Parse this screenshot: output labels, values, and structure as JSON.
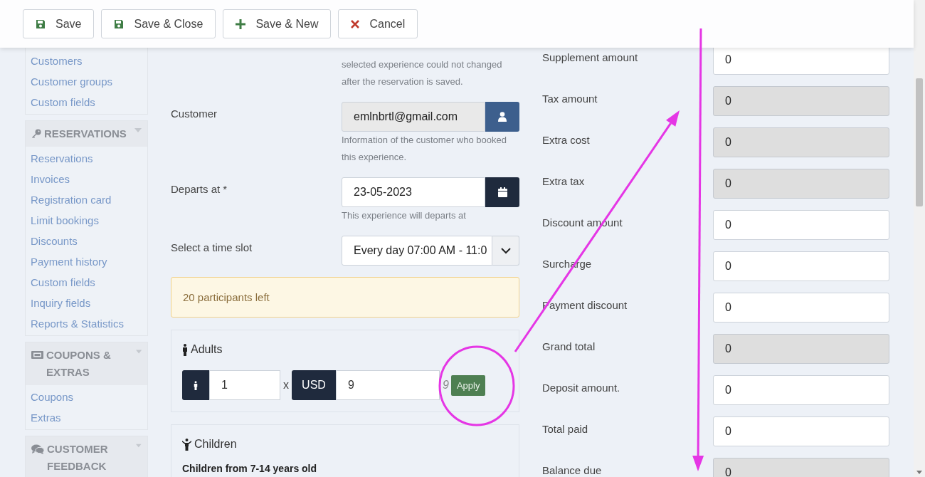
{
  "toolbar": {
    "buttons": [
      {
        "label": "Save",
        "kind": "save"
      },
      {
        "label": "Save & Close",
        "kind": "save"
      },
      {
        "label": "Save & New",
        "kind": "plus"
      },
      {
        "label": "Cancel",
        "kind": "cancel"
      }
    ]
  },
  "sidebar": {
    "groups": [
      {
        "items": [
          "Customers",
          "Customer groups",
          "Custom fields"
        ]
      },
      {
        "title": "RESERVATIONS",
        "kind": "key",
        "items": [
          "Reservations",
          "Invoices",
          "Registration card",
          "Limit bookings",
          "Discounts",
          "Payment history",
          "Custom fields",
          "Inquiry fields",
          "Reports & Statistics"
        ]
      },
      {
        "title": "COUPONS & EXTRAS",
        "kind": "ticket",
        "items": [
          "Coupons",
          "Extras"
        ]
      },
      {
        "title": "CUSTOMER FEEDBACK",
        "kind": "comments"
      }
    ]
  },
  "form": {
    "experience_help": "selected experience could not changed after the reservation is saved.",
    "fields": [
      {
        "label": "Customer",
        "kind": "lookup",
        "value": "emlnbrtl@gmail.com",
        "readonly": true,
        "help": "Information of the customer who booked this experience."
      },
      {
        "label": "Departs at *",
        "kind": "date",
        "value": "23-05-2023",
        "readonly": false,
        "help": "This experience will departs at"
      },
      {
        "label": "Select a time slot",
        "kind": "select",
        "value": "Every day 07:00 AM - 11:0",
        "readonly": false
      }
    ],
    "alert": "20 participants left",
    "adults": {
      "title": "Adults",
      "quantity": "1",
      "times": "x",
      "currency": "USD",
      "price": "9",
      "total": "9",
      "apply": "Apply"
    },
    "children": {
      "title": "Children",
      "description": "Children from 7-14 years old"
    }
  },
  "totals": [
    {
      "label": "Supplement amount",
      "value": "0",
      "readonly": false
    },
    {
      "label": "Tax amount",
      "value": "0",
      "readonly": true
    },
    {
      "label": "Extra cost",
      "value": "0",
      "readonly": true
    },
    {
      "label": "Extra tax",
      "value": "0",
      "readonly": true
    },
    {
      "label": "Discount amount",
      "value": "0",
      "readonly": false
    },
    {
      "label": "Surcharge",
      "value": "0",
      "readonly": false
    },
    {
      "label": "Payment discount",
      "value": "0",
      "readonly": false
    },
    {
      "label": "Grand total",
      "value": "0",
      "readonly": true
    },
    {
      "label": "Deposit amount.",
      "value": "0",
      "readonly": false
    },
    {
      "label": "Total paid",
      "value": "0",
      "readonly": false
    },
    {
      "label": "Balance due",
      "value": "0",
      "readonly": true
    }
  ],
  "annotations": [
    {
      "kind": "circle"
    },
    {
      "kind": "arrow"
    },
    {
      "kind": "arrow"
    }
  ]
}
